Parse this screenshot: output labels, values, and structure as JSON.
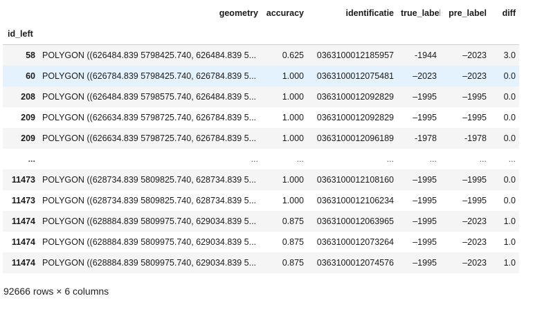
{
  "columns": [
    "geometry",
    "accuracy",
    "identificatie",
    "true_label",
    "pre_label",
    "diff"
  ],
  "index_name": "id_left",
  "rows": [
    {
      "idx": "58",
      "geometry": "POLYGON ((626484.839 5798425.740, 626484.839 5...",
      "accuracy": "0.625",
      "identificatie": "0363100012185957",
      "true_label": "-1944",
      "pre_label": "–2023",
      "diff": "3.0"
    },
    {
      "idx": "60",
      "geometry": "POLYGON ((626784.839 5798425.740, 626784.839 5...",
      "accuracy": "1.000",
      "identificatie": "0363100012075481",
      "true_label": "–2023",
      "pre_label": "–2023",
      "diff": "0.0"
    },
    {
      "idx": "208",
      "geometry": "POLYGON ((626484.839 5798575.740, 626484.839 5...",
      "accuracy": "1.000",
      "identificatie": "0363100012092829",
      "true_label": "–1995",
      "pre_label": "–1995",
      "diff": "0.0"
    },
    {
      "idx": "209",
      "geometry": "POLYGON ((626634.839 5798725.740, 626784.839 5...",
      "accuracy": "1.000",
      "identificatie": "0363100012092829",
      "true_label": "–1995",
      "pre_label": "–1995",
      "diff": "0.0"
    },
    {
      "idx": "209",
      "geometry": "POLYGON ((626634.839 5798725.740, 626784.839 5...",
      "accuracy": "1.000",
      "identificatie": "0363100012096189",
      "true_label": "-1978",
      "pre_label": "-1978",
      "diff": "0.0"
    },
    {
      "idx": "...",
      "geometry": "...",
      "accuracy": "...",
      "identificatie": "...",
      "true_label": "...",
      "pre_label": "...",
      "diff": "..."
    },
    {
      "idx": "11473",
      "geometry": "POLYGON ((628734.839 5809825.740, 628734.839 5...",
      "accuracy": "1.000",
      "identificatie": "0363100012108160",
      "true_label": "–1995",
      "pre_label": "–1995",
      "diff": "0.0"
    },
    {
      "idx": "11473",
      "geometry": "POLYGON ((628734.839 5809825.740, 628734.839 5...",
      "accuracy": "1.000",
      "identificatie": "0363100012106234",
      "true_label": "–1995",
      "pre_label": "–1995",
      "diff": "0.0"
    },
    {
      "idx": "11474",
      "geometry": "POLYGON ((628884.839 5809975.740, 629034.839 5...",
      "accuracy": "0.875",
      "identificatie": "0363100012063965",
      "true_label": "–1995",
      "pre_label": "–2023",
      "diff": "1.0"
    },
    {
      "idx": "11474",
      "geometry": "POLYGON ((628884.839 5809975.740, 629034.839 5...",
      "accuracy": "0.875",
      "identificatie": "0363100012073264",
      "true_label": "–1995",
      "pre_label": "–2023",
      "diff": "1.0"
    },
    {
      "idx": "11474",
      "geometry": "POLYGON ((628884.839 5809975.740, 629034.839 5...",
      "accuracy": "0.875",
      "identificatie": "0363100012074576",
      "true_label": "–1995",
      "pre_label": "–2023",
      "diff": "1.0"
    }
  ],
  "footer": "92666 rows × 6 columns",
  "colors": {
    "stripe": "#f5f5f5",
    "hover_highlight": "#e4f2fd",
    "text": "#1a1a1a"
  }
}
